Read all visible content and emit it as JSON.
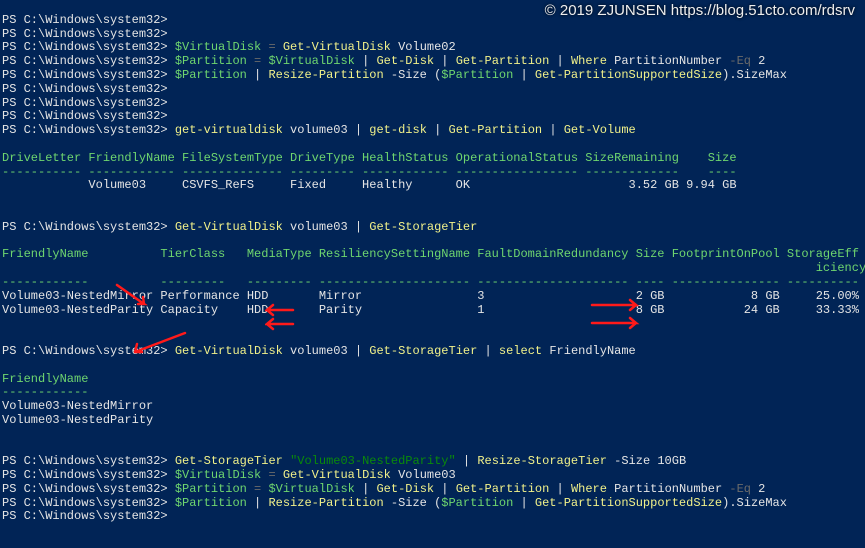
{
  "watermark": "© 2019 ZJUNSEN https://blog.51cto.com/rdsrv",
  "prompt": "PS C:\\Windows\\system32>",
  "lines": {
    "l1": "PS C:\\Windows\\system32>",
    "l2": "PS C:\\Windows\\system32>",
    "l3p": "PS C:\\Windows\\system32> ",
    "l3a": "$VirtualDisk",
    "l3b": " = ",
    "l3c": "Get-VirtualDisk",
    "l3d": " Volume02",
    "l4p": "PS C:\\Windows\\system32> ",
    "l4a": "$Partition",
    "l4b": " = ",
    "l4c": "$VirtualDisk",
    "l4d": " | ",
    "l4e": "Get-Disk",
    "l4f": " | ",
    "l4g": "Get-Partition",
    "l4h": " | ",
    "l4i": "Where",
    "l4j": " PartitionNumber ",
    "l4k": "-Eq",
    "l4l": " 2",
    "l5p": "PS C:\\Windows\\system32> ",
    "l5a": "$Partition",
    "l5b": " | ",
    "l5c": "Resize-Partition",
    "l5d": " -Size (",
    "l5e": "$Partition",
    "l5f": " | ",
    "l5g": "Get-PartitionSupportedSize",
    "l5h": ").SizeMax",
    "l6": "PS C:\\Windows\\system32>",
    "l7": "PS C:\\Windows\\system32>",
    "l8": "PS C:\\Windows\\system32>",
    "l9p": "PS C:\\Windows\\system32> ",
    "l9a": "get-virtualdisk",
    "l9b": " volume03 | ",
    "l9c": "get-disk",
    "l9d": " | ",
    "l9e": "Get-Partition",
    "l9f": " | ",
    "l9g": "Get-Volume",
    "tbl1_hdr": "DriveLetter FriendlyName FileSystemType DriveType HealthStatus OperationalStatus SizeRemaining    Size",
    "tbl1_sep": "----------- ------------ -------------- --------- ------------ ----------------- -------------    ----",
    "tbl1_row": "            Volume03     CSVFS_ReFS     Fixed     Healthy      OK                      3.52 GB 9.94 GB",
    "l13p": "PS C:\\Windows\\system32> ",
    "l13a": "Get-VirtualDisk",
    "l13b": " volume03 | ",
    "l13c": "Get-StorageTier",
    "tbl2_hdr1": "FriendlyName          TierClass   MediaType ResiliencySettingName FaultDomainRedundancy Size FootprintOnPool StorageEff",
    "tbl2_hdr2": "                                                                                                                 iciency",
    "tbl2_sep": "------------          ---------   --------- --------------------- --------------------- ---- --------------- ----------",
    "tbl2_r1": "Volume03-NestedMirror Performance HDD       Mirror                3                     2 GB            8 GB     25.00%",
    "tbl2_r2": "Volume03-NestedParity Capacity    HDD       Parity                1                     8 GB           24 GB     33.33%",
    "l18p": "PS C:\\Windows\\system32> ",
    "l18a": "Get-VirtualDisk",
    "l18b": " volume03 | ",
    "l18c": "Get-StorageTier",
    "l18d": " | ",
    "l18e": "select",
    "l18f": " FriendlyName",
    "tbl3_hdr": "FriendlyName",
    "tbl3_sep": "------------",
    "tbl3_r1": "Volume03-NestedMirror",
    "tbl3_r2": "Volume03-NestedParity",
    "l24p": "PS C:\\Windows\\system32> ",
    "l24a": "Get-StorageTier",
    "l24b": " ",
    "l24c": "\"Volume03-NestedParity\"",
    "l24d": " | ",
    "l24e": "Resize-StorageTier",
    "l24f": " -Size 10GB",
    "l25p": "PS C:\\Windows\\system32> ",
    "l25a": "$VirtualDisk",
    "l25b": " = ",
    "l25c": "Get-VirtualDisk",
    "l25d": " Volume03",
    "l26p": "PS C:\\Windows\\system32> ",
    "l26a": "$Partition",
    "l26b": " = ",
    "l26c": "$VirtualDisk",
    "l26d": " | ",
    "l26e": "Get-Disk",
    "l26f": " | ",
    "l26g": "Get-Partition",
    "l26h": " | ",
    "l26i": "Where",
    "l26j": " PartitionNumber ",
    "l26k": "-Eq",
    "l26l": " 2",
    "l27p": "PS C:\\Windows\\system32> ",
    "l27a": "$Partition",
    "l27b": " | ",
    "l27c": "Resize-Partition",
    "l27d": " -Size (",
    "l27e": "$Partition",
    "l27f": " | ",
    "l27g": "Get-PartitionSupportedSize",
    "l27h": ").SizeMax",
    "l28": "PS C:\\Windows\\system32>"
  }
}
